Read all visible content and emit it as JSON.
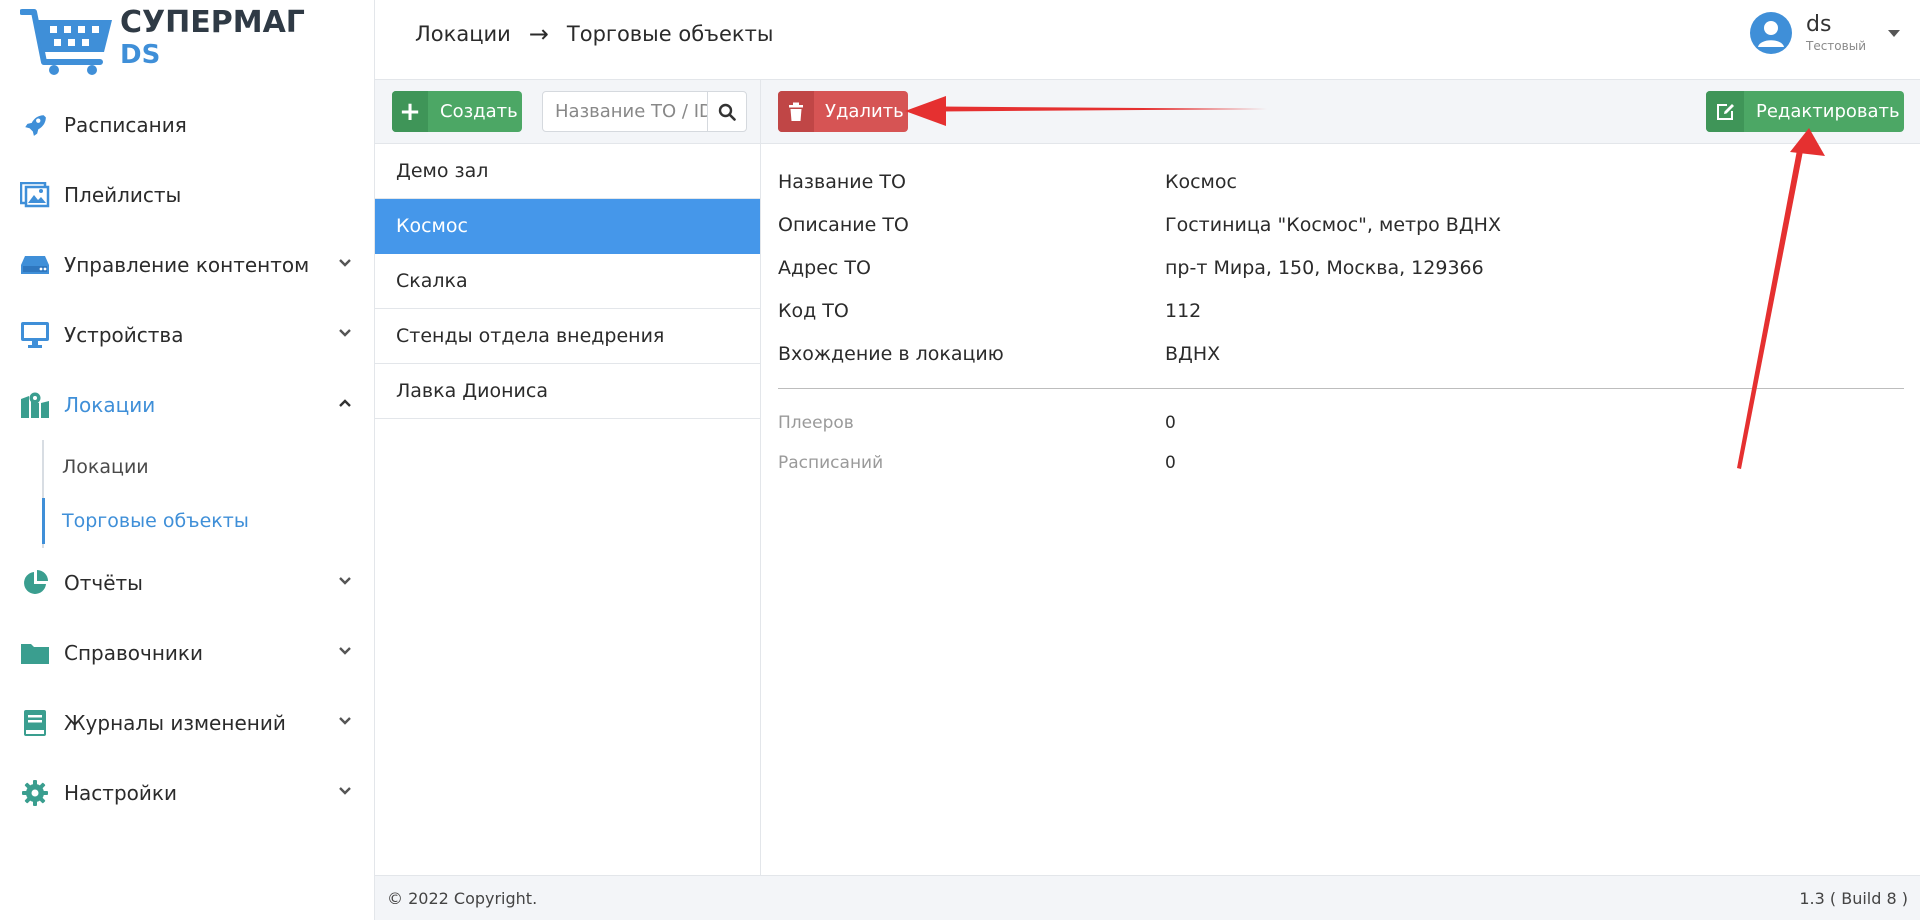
{
  "brand": {
    "line1": "СУПЕРМАГ",
    "line2": "DS"
  },
  "sidebar": {
    "items": [
      {
        "label": "Расписания",
        "icon": "rocket-icon"
      },
      {
        "label": "Плейлисты",
        "icon": "images-icon"
      },
      {
        "label": "Управление контентом",
        "icon": "hdd-icon"
      },
      {
        "label": "Устройства",
        "icon": "monitor-icon"
      },
      {
        "label": "Локации",
        "icon": "map-icon"
      },
      {
        "label": "Отчёты",
        "icon": "pie-chart-icon"
      },
      {
        "label": "Справочники",
        "icon": "folder-icon"
      },
      {
        "label": "Журналы изменений",
        "icon": "book-icon"
      },
      {
        "label": "Настройки",
        "icon": "gear-icon"
      }
    ],
    "submenu": [
      {
        "label": "Локации"
      },
      {
        "label": "Торговые объекты"
      }
    ]
  },
  "header": {
    "crumb1": "Локации",
    "crumb_sep": "→",
    "crumb2": "Торговые объекты",
    "user_name": "ds",
    "user_role": "Тестовый"
  },
  "list": {
    "create_label": "Создать",
    "search_placeholder": "Название ТО / ID",
    "items": [
      {
        "label": "Демо зал"
      },
      {
        "label": "Космос"
      },
      {
        "label": "Скалка"
      },
      {
        "label": "Стенды отдела внедрения"
      },
      {
        "label": "Лавка Диониса"
      }
    ]
  },
  "detail": {
    "delete_label": "Удалить",
    "edit_label": "Редактировать",
    "fields": [
      {
        "key": "Название ТО",
        "value": "Космос"
      },
      {
        "key": "Описание ТО",
        "value": "Гостиница \"Космос\", метро ВДНХ"
      },
      {
        "key": "Адрес ТО",
        "value": "пр-т Мира, 150, Москва, 129366"
      },
      {
        "key": "Код ТО",
        "value": "112"
      },
      {
        "key": "Вхождение в локацию",
        "value": "ВДНХ"
      }
    ],
    "stats": [
      {
        "key": "Плееров",
        "value": "0"
      },
      {
        "key": "Расписаний",
        "value": "0"
      }
    ]
  },
  "footer": {
    "copyright": "© 2022 Copyright.",
    "version": "1.3 ( Build 8 )"
  },
  "colors": {
    "accent": "#3f8fd8",
    "selected": "#4597ea",
    "success": "#4ca765",
    "danger": "#d65454",
    "menu_icon": "#3a9e8f",
    "annotation": "#e53030"
  }
}
